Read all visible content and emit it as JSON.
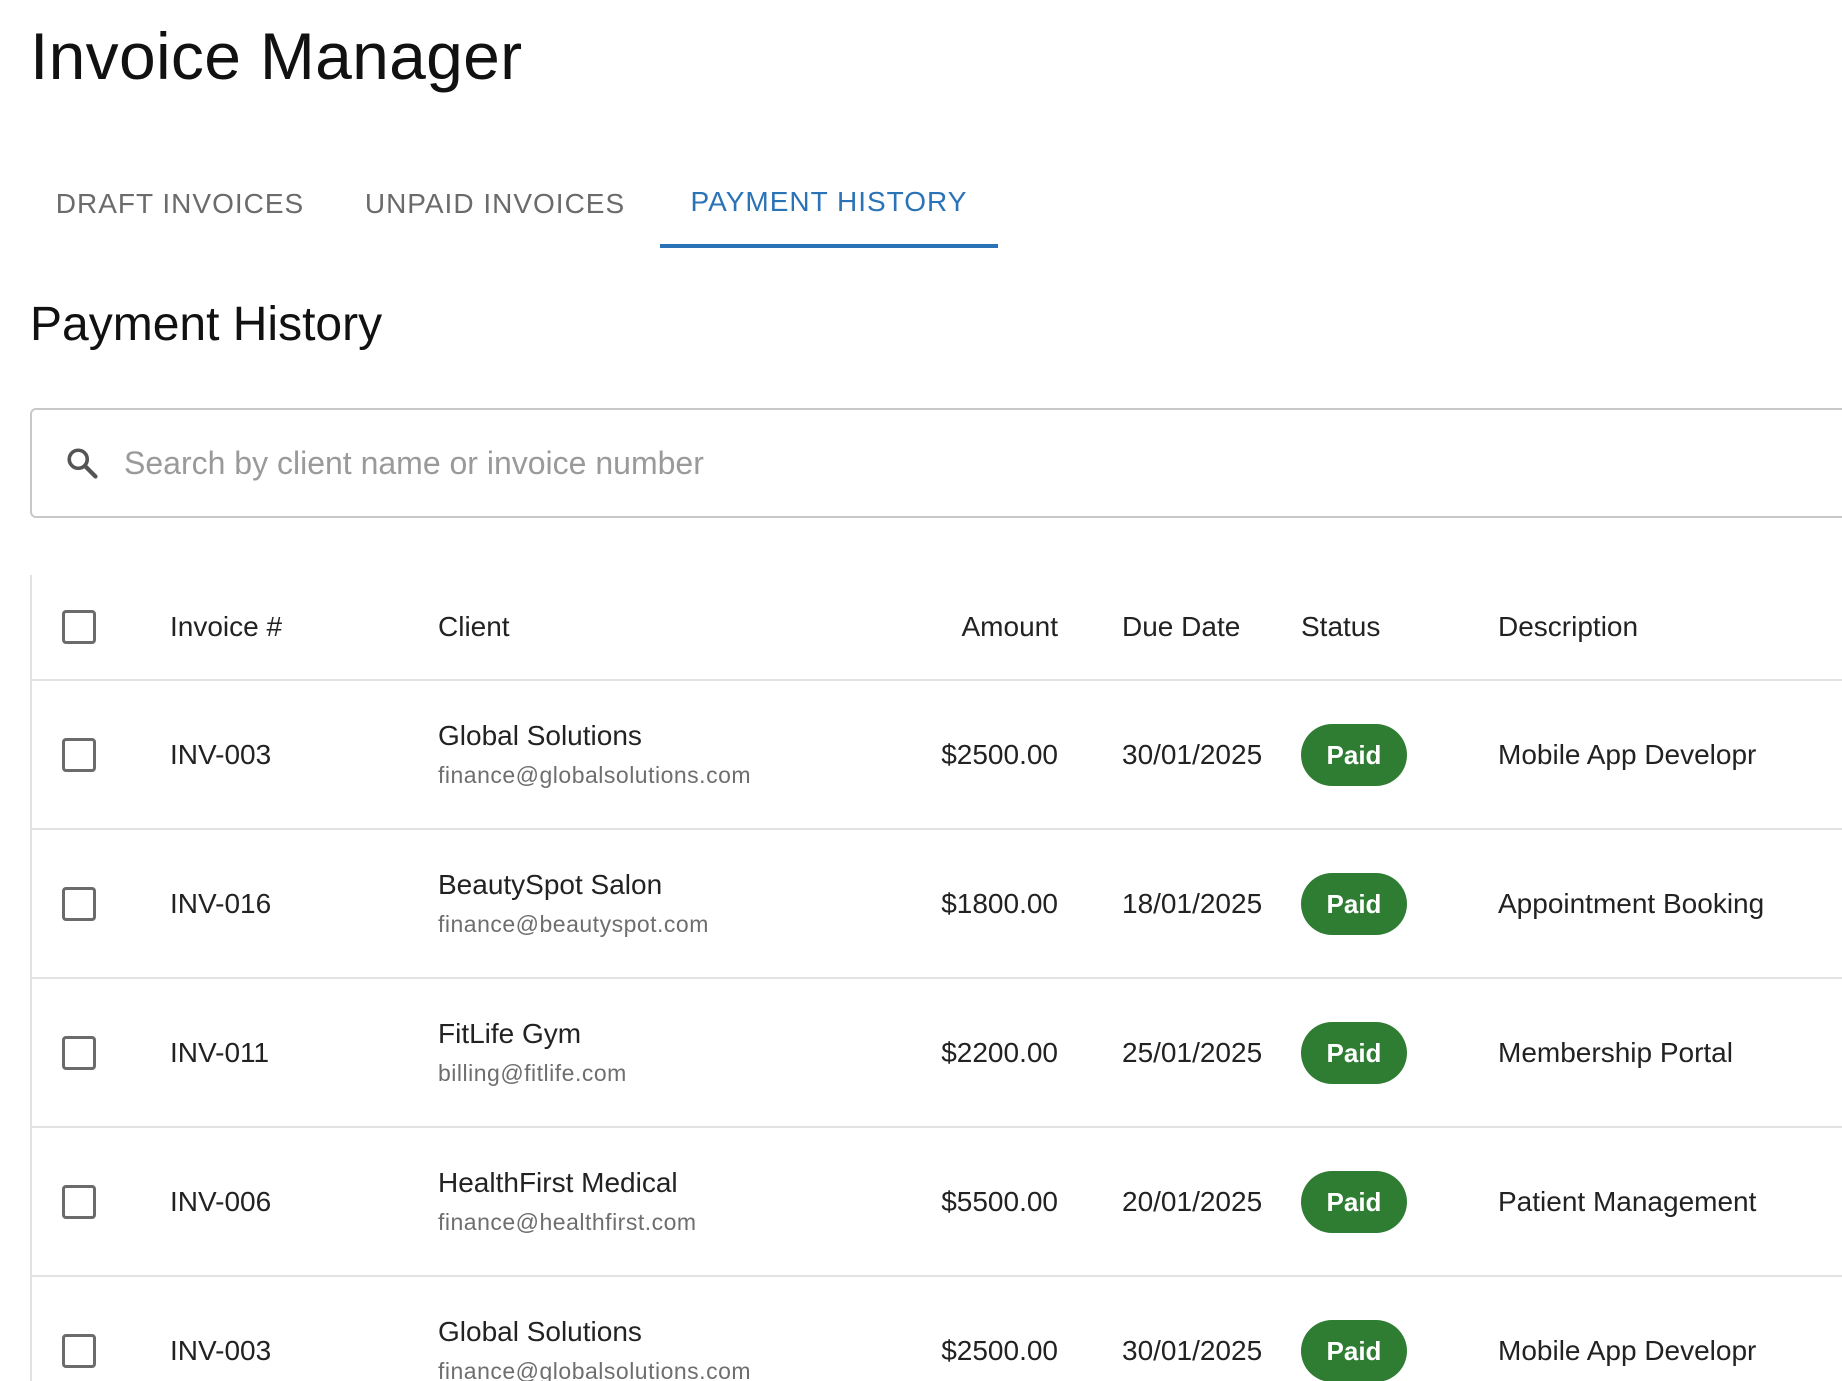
{
  "app": {
    "title": "Invoice Manager"
  },
  "tabs": [
    {
      "label": "DRAFT INVOICES",
      "active": false
    },
    {
      "label": "UNPAID INVOICES",
      "active": false
    },
    {
      "label": "PAYMENT HISTORY",
      "active": true
    }
  ],
  "section": {
    "title": "Payment History"
  },
  "search": {
    "placeholder": "Search by client name or invoice number",
    "value": ""
  },
  "table": {
    "headers": {
      "invoice": "Invoice #",
      "client": "Client",
      "amount": "Amount",
      "due_date": "Due Date",
      "status": "Status",
      "description": "Description"
    },
    "rows": [
      {
        "invoice": "INV-003",
        "client_name": "Global Solutions",
        "client_email": "finance@globalsolutions.com",
        "amount": "$2500.00",
        "due_date": "30/01/2025",
        "status": "Paid",
        "description": "Mobile App Developr"
      },
      {
        "invoice": "INV-016",
        "client_name": "BeautySpot Salon",
        "client_email": "finance@beautyspot.com",
        "amount": "$1800.00",
        "due_date": "18/01/2025",
        "status": "Paid",
        "description": "Appointment Booking"
      },
      {
        "invoice": "INV-011",
        "client_name": "FitLife Gym",
        "client_email": "billing@fitlife.com",
        "amount": "$2200.00",
        "due_date": "25/01/2025",
        "status": "Paid",
        "description": "Membership Portal"
      },
      {
        "invoice": "INV-006",
        "client_name": "HealthFirst Medical",
        "client_email": "finance@healthfirst.com",
        "amount": "$5500.00",
        "due_date": "20/01/2025",
        "status": "Paid",
        "description": "Patient Management"
      },
      {
        "invoice": "INV-003",
        "client_name": "Global Solutions",
        "client_email": "finance@globalsolutions.com",
        "amount": "$2500.00",
        "due_date": "30/01/2025",
        "status": "Paid",
        "description": "Mobile App Developr"
      }
    ]
  },
  "colors": {
    "accent": "#2b73b7",
    "paid_badge": "#2e7d32",
    "border": "#e2e2e2"
  },
  "icons": {
    "search": "search-icon",
    "checkbox": "checkbox-unchecked"
  }
}
